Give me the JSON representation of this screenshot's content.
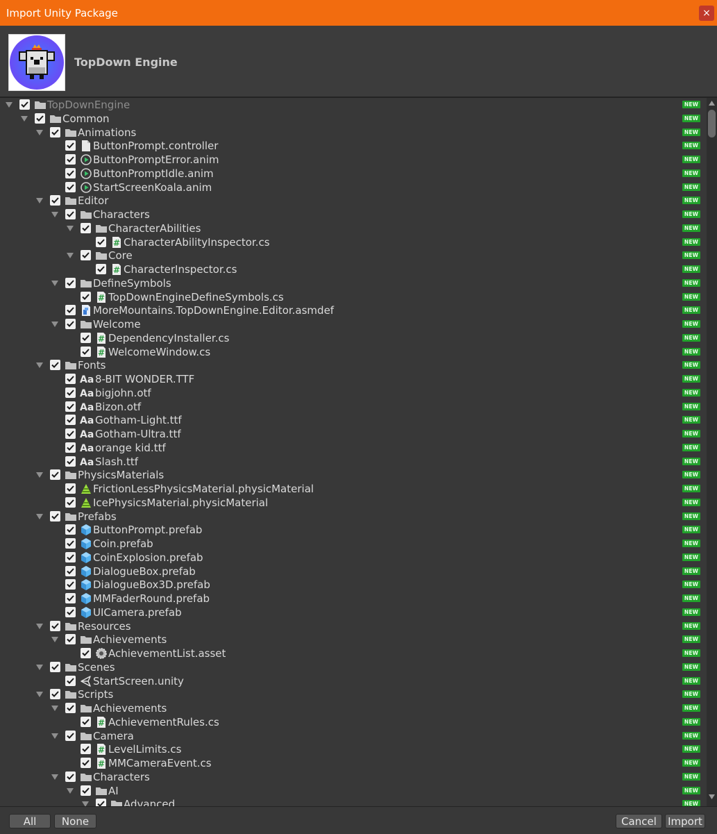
{
  "window": {
    "title": "Import Unity Package",
    "close_glyph": "×"
  },
  "package": {
    "name": "TopDown Engine"
  },
  "badge_text": "NEW",
  "buttons": {
    "all": "All",
    "none": "None",
    "cancel": "Cancel",
    "import": "Import"
  },
  "tree": [
    {
      "label": "TopDownEngine",
      "depth": 0,
      "type": "folder",
      "expandable": true,
      "dim": true
    },
    {
      "label": "Common",
      "depth": 1,
      "type": "folder",
      "expandable": true
    },
    {
      "label": "Animations",
      "depth": 2,
      "type": "folder",
      "expandable": true
    },
    {
      "label": "ButtonPrompt.controller",
      "depth": 3,
      "type": "file"
    },
    {
      "label": "ButtonPromptError.anim",
      "depth": 3,
      "type": "anim"
    },
    {
      "label": "ButtonPromptIdle.anim",
      "depth": 3,
      "type": "anim"
    },
    {
      "label": "StartScreenKoala.anim",
      "depth": 3,
      "type": "anim"
    },
    {
      "label": "Editor",
      "depth": 2,
      "type": "folder",
      "expandable": true
    },
    {
      "label": "Characters",
      "depth": 3,
      "type": "folder",
      "expandable": true
    },
    {
      "label": "CharacterAbilities",
      "depth": 4,
      "type": "folder",
      "expandable": true
    },
    {
      "label": "CharacterAbilityInspector.cs",
      "depth": 5,
      "type": "script"
    },
    {
      "label": "Core",
      "depth": 4,
      "type": "folder",
      "expandable": true
    },
    {
      "label": "CharacterInspector.cs",
      "depth": 5,
      "type": "script"
    },
    {
      "label": "DefineSymbols",
      "depth": 3,
      "type": "folder",
      "expandable": true
    },
    {
      "label": "TopDownEngineDefineSymbols.cs",
      "depth": 4,
      "type": "script"
    },
    {
      "label": "MoreMountains.TopDownEngine.Editor.asmdef",
      "depth": 3,
      "type": "asmdef"
    },
    {
      "label": "Welcome",
      "depth": 3,
      "type": "folder",
      "expandable": true
    },
    {
      "label": "DependencyInstaller.cs",
      "depth": 4,
      "type": "script"
    },
    {
      "label": "WelcomeWindow.cs",
      "depth": 4,
      "type": "script"
    },
    {
      "label": "Fonts",
      "depth": 2,
      "type": "folder",
      "expandable": true
    },
    {
      "label": "8-BIT WONDER.TTF",
      "depth": 3,
      "type": "font"
    },
    {
      "label": "bigjohn.otf",
      "depth": 3,
      "type": "font"
    },
    {
      "label": "Bizon.otf",
      "depth": 3,
      "type": "font"
    },
    {
      "label": "Gotham-Light.ttf",
      "depth": 3,
      "type": "font"
    },
    {
      "label": "Gotham-Ultra.ttf",
      "depth": 3,
      "type": "font"
    },
    {
      "label": "orange kid.ttf",
      "depth": 3,
      "type": "font"
    },
    {
      "label": "Slash.ttf",
      "depth": 3,
      "type": "font"
    },
    {
      "label": "PhysicsMaterials",
      "depth": 2,
      "type": "folder",
      "expandable": true
    },
    {
      "label": "FrictionLessPhysicsMaterial.physicMaterial",
      "depth": 3,
      "type": "physic"
    },
    {
      "label": "IcePhysicsMaterial.physicMaterial",
      "depth": 3,
      "type": "physic"
    },
    {
      "label": "Prefabs",
      "depth": 2,
      "type": "folder",
      "expandable": true
    },
    {
      "label": "ButtonPrompt.prefab",
      "depth": 3,
      "type": "prefab"
    },
    {
      "label": "Coin.prefab",
      "depth": 3,
      "type": "prefab"
    },
    {
      "label": "CoinExplosion.prefab",
      "depth": 3,
      "type": "prefab"
    },
    {
      "label": "DialogueBox.prefab",
      "depth": 3,
      "type": "prefab"
    },
    {
      "label": "DialogueBox3D.prefab",
      "depth": 3,
      "type": "prefab"
    },
    {
      "label": "MMFaderRound.prefab",
      "depth": 3,
      "type": "prefab"
    },
    {
      "label": "UICamera.prefab",
      "depth": 3,
      "type": "prefab"
    },
    {
      "label": "Resources",
      "depth": 2,
      "type": "folder",
      "expandable": true
    },
    {
      "label": "Achievements",
      "depth": 3,
      "type": "folder",
      "expandable": true
    },
    {
      "label": "AchievementList.asset",
      "depth": 4,
      "type": "asset"
    },
    {
      "label": "Scenes",
      "depth": 2,
      "type": "folder",
      "expandable": true
    },
    {
      "label": "StartScreen.unity",
      "depth": 3,
      "type": "scene"
    },
    {
      "label": "Scripts",
      "depth": 2,
      "type": "folder",
      "expandable": true
    },
    {
      "label": "Achievements",
      "depth": 3,
      "type": "folder",
      "expandable": true
    },
    {
      "label": "AchievementRules.cs",
      "depth": 4,
      "type": "script"
    },
    {
      "label": "Camera",
      "depth": 3,
      "type": "folder",
      "expandable": true
    },
    {
      "label": "LevelLimits.cs",
      "depth": 4,
      "type": "script"
    },
    {
      "label": "MMCameraEvent.cs",
      "depth": 4,
      "type": "script"
    },
    {
      "label": "Characters",
      "depth": 3,
      "type": "folder",
      "expandable": true
    },
    {
      "label": "AI",
      "depth": 4,
      "type": "folder",
      "expandable": true
    },
    {
      "label": "Advanced",
      "depth": 5,
      "type": "folder",
      "expandable": true
    }
  ]
}
